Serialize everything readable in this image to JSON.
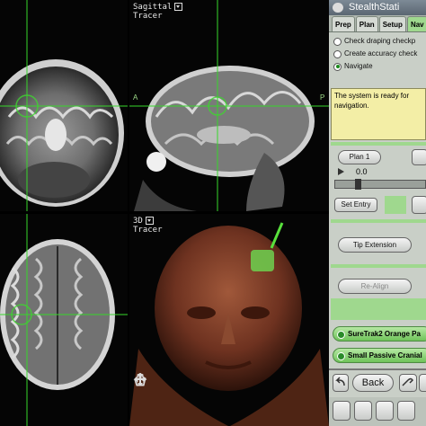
{
  "viewports": {
    "coronal": {
      "label": ""
    },
    "sagittal": {
      "label_line1": "Sagittal",
      "label_line2": "Tracer",
      "left_marker": "A",
      "right_marker": "P"
    },
    "axial": {
      "label": ""
    },
    "three_d": {
      "label_line1": "3D",
      "label_line2": "Tracer"
    }
  },
  "tools": [
    "hand-icon",
    "move-icon",
    "home-icon"
  ],
  "panel": {
    "title": "StealthStati",
    "tabs": [
      "Prep",
      "Plan",
      "Setup",
      "Nav"
    ],
    "active_tab": "Nav",
    "steps": [
      {
        "label": "Check draping checkp",
        "selected": false
      },
      {
        "label": "Create accuracy check",
        "selected": false
      },
      {
        "label": "Navigate",
        "selected": true
      }
    ],
    "message": "The system is ready for navigation.",
    "plan_button": "Plan 1",
    "depth_value": "0.0",
    "set_entry_button": "Set Entry",
    "tip_extension_button": "Tip Extension",
    "realign_button": "Re-Align",
    "instruments": [
      "SureTrak2 Orange Pa",
      "Small Passive Cranial"
    ],
    "back_button": "Back",
    "colors": {
      "accent_green": "#9fd88e",
      "crosshair": "#37d62b",
      "message_bg": "#f3eea6"
    }
  }
}
